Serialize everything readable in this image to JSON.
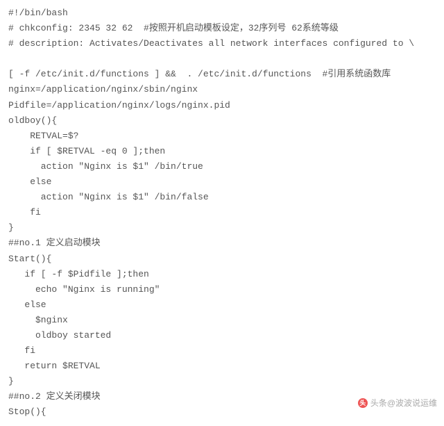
{
  "code_lines": [
    "#!/bin/bash",
    "# chkconfig: 2345 32 62  #按照开机启动模板设定，32序列号 62系统等级",
    "# description: Activates/Deactivates all network interfaces configured to \\",
    "",
    "[ -f /etc/init.d/functions ] &&  . /etc/init.d/functions  #引用系统函数库",
    "nginx=/application/nginx/sbin/nginx",
    "Pidfile=/application/nginx/logs/nginx.pid",
    "oldboy(){",
    "    RETVAL=$?",
    "    if [ $RETVAL -eq 0 ];then",
    "      action \"Nginx is $1\" /bin/true",
    "    else",
    "      action \"Nginx is $1\" /bin/false",
    "    fi",
    "}",
    "##no.1 定义启动模块",
    "Start(){",
    "   if [ -f $Pidfile ];then",
    "     echo \"Nginx is running\"",
    "   else",
    "     $nginx",
    "     oldboy started",
    "   fi",
    "   return $RETVAL",
    "}",
    "##no.2 定义关闭模块",
    "Stop(){"
  ],
  "watermark": {
    "icon_text": "头",
    "label": "头条@波波说运维"
  }
}
